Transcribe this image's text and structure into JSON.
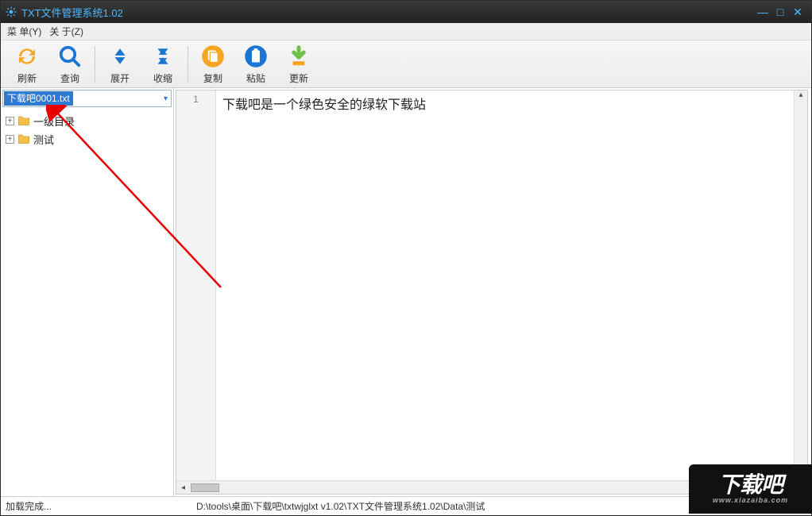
{
  "title": "TXT文件管理系统1.02",
  "menu": {
    "file": "菜 单(Y)",
    "about": "关 于(Z)"
  },
  "toolbar": {
    "refresh": "刷新",
    "search": "查询",
    "expand": "展开",
    "collapse": "收缩",
    "copy": "复制",
    "paste": "粘贴",
    "update": "更新"
  },
  "combo": {
    "selected": "下载吧0001.txt"
  },
  "tree": {
    "items": [
      {
        "label": "一级目录"
      },
      {
        "label": "测试"
      }
    ]
  },
  "editor": {
    "line_number": "1",
    "content": "下载吧是一个绿色安全的绿软下载站"
  },
  "status": {
    "left": "加载完成...",
    "path": "D:\\tools\\桌面\\下载吧\\txtwjglxt v1.02\\TXT文件管理系统1.02\\Data\\测试"
  },
  "watermark": {
    "big": "下载吧",
    "small": "www.xiazaiba.com"
  }
}
